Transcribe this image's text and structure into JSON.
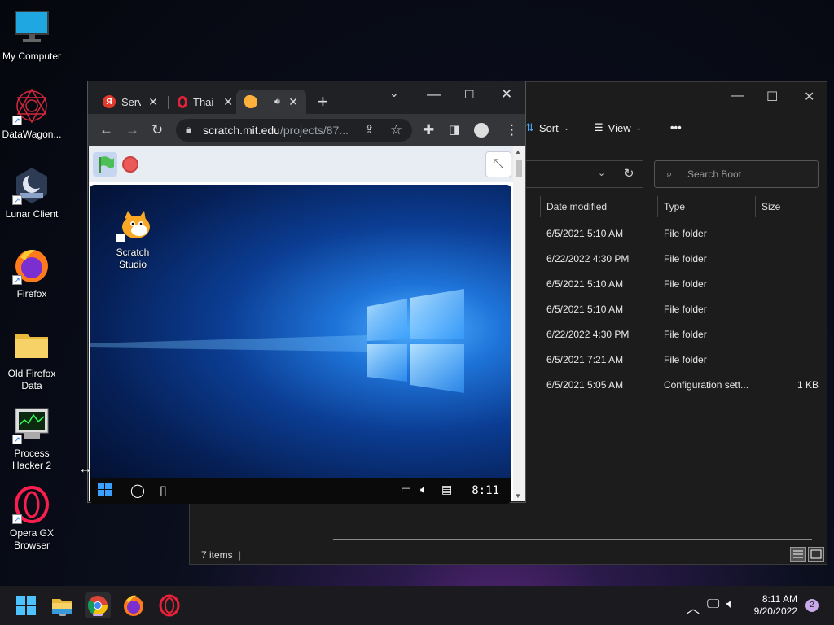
{
  "desktop": {
    "icons": [
      {
        "label": "My Computer",
        "icon": "monitor-icon"
      },
      {
        "label": "DataWagon...",
        "icon": "datawagon-icon"
      },
      {
        "label": "Lunar Client",
        "icon": "lunar-client-icon"
      },
      {
        "label": "Firefox",
        "icon": "firefox-icon"
      },
      {
        "label": "Old Firefox Data",
        "icon": "folder-icon"
      },
      {
        "label": "Process Hacker 2",
        "icon": "process-hacker-icon"
      },
      {
        "label": "Opera GX Browser",
        "icon": "opera-gx-icon"
      }
    ]
  },
  "explorer": {
    "toolbar": {
      "sort_label": "Sort",
      "view_label": "View",
      "more_label": "•••"
    },
    "search_placeholder": "Search Boot",
    "columns": {
      "date": "Date modified",
      "type": "Type",
      "size": "Size"
    },
    "rows": [
      {
        "date": "6/5/2021 5:10 AM",
        "type": "File folder",
        "size": ""
      },
      {
        "date": "6/22/2022 4:30 PM",
        "type": "File folder",
        "size": ""
      },
      {
        "date": "6/5/2021 5:10 AM",
        "type": "File folder",
        "size": ""
      },
      {
        "date": "6/5/2021 5:10 AM",
        "type": "File folder",
        "size": ""
      },
      {
        "date": "6/22/2022 4:30 PM",
        "type": "File folder",
        "size": ""
      },
      {
        "date": "6/5/2021 7:21 AM",
        "type": "File folder",
        "size": ""
      },
      {
        "date": "6/5/2021 5:05 AM",
        "type": "Configuration sett...",
        "size": "1 KB"
      }
    ],
    "status": "7 items"
  },
  "browser": {
    "tabs": [
      {
        "title": "Serv",
        "favicon": "yandex-icon"
      },
      {
        "title": "Thai",
        "favicon": "opera-icon"
      },
      {
        "title": "",
        "favicon": "scratch-icon",
        "active": true
      }
    ],
    "url_host": "scratch.mit.edu",
    "url_path": "/projects/87...",
    "stage": {
      "desktop_icon_label_1": "Scratch",
      "desktop_icon_label_2": "Studio",
      "clock": "8:11"
    }
  },
  "taskbar": {
    "apps": [
      "windows-start-icon",
      "file-explorer-icon",
      "chrome-icon",
      "firefox-icon",
      "opera-icon"
    ],
    "time": "8:11 AM",
    "date": "9/20/2022",
    "notification_count": "2"
  },
  "colors": {
    "accent": "#2a6fd6",
    "explorer_bg": "#1c1c1c",
    "chrome_toolbar": "#35363a"
  }
}
